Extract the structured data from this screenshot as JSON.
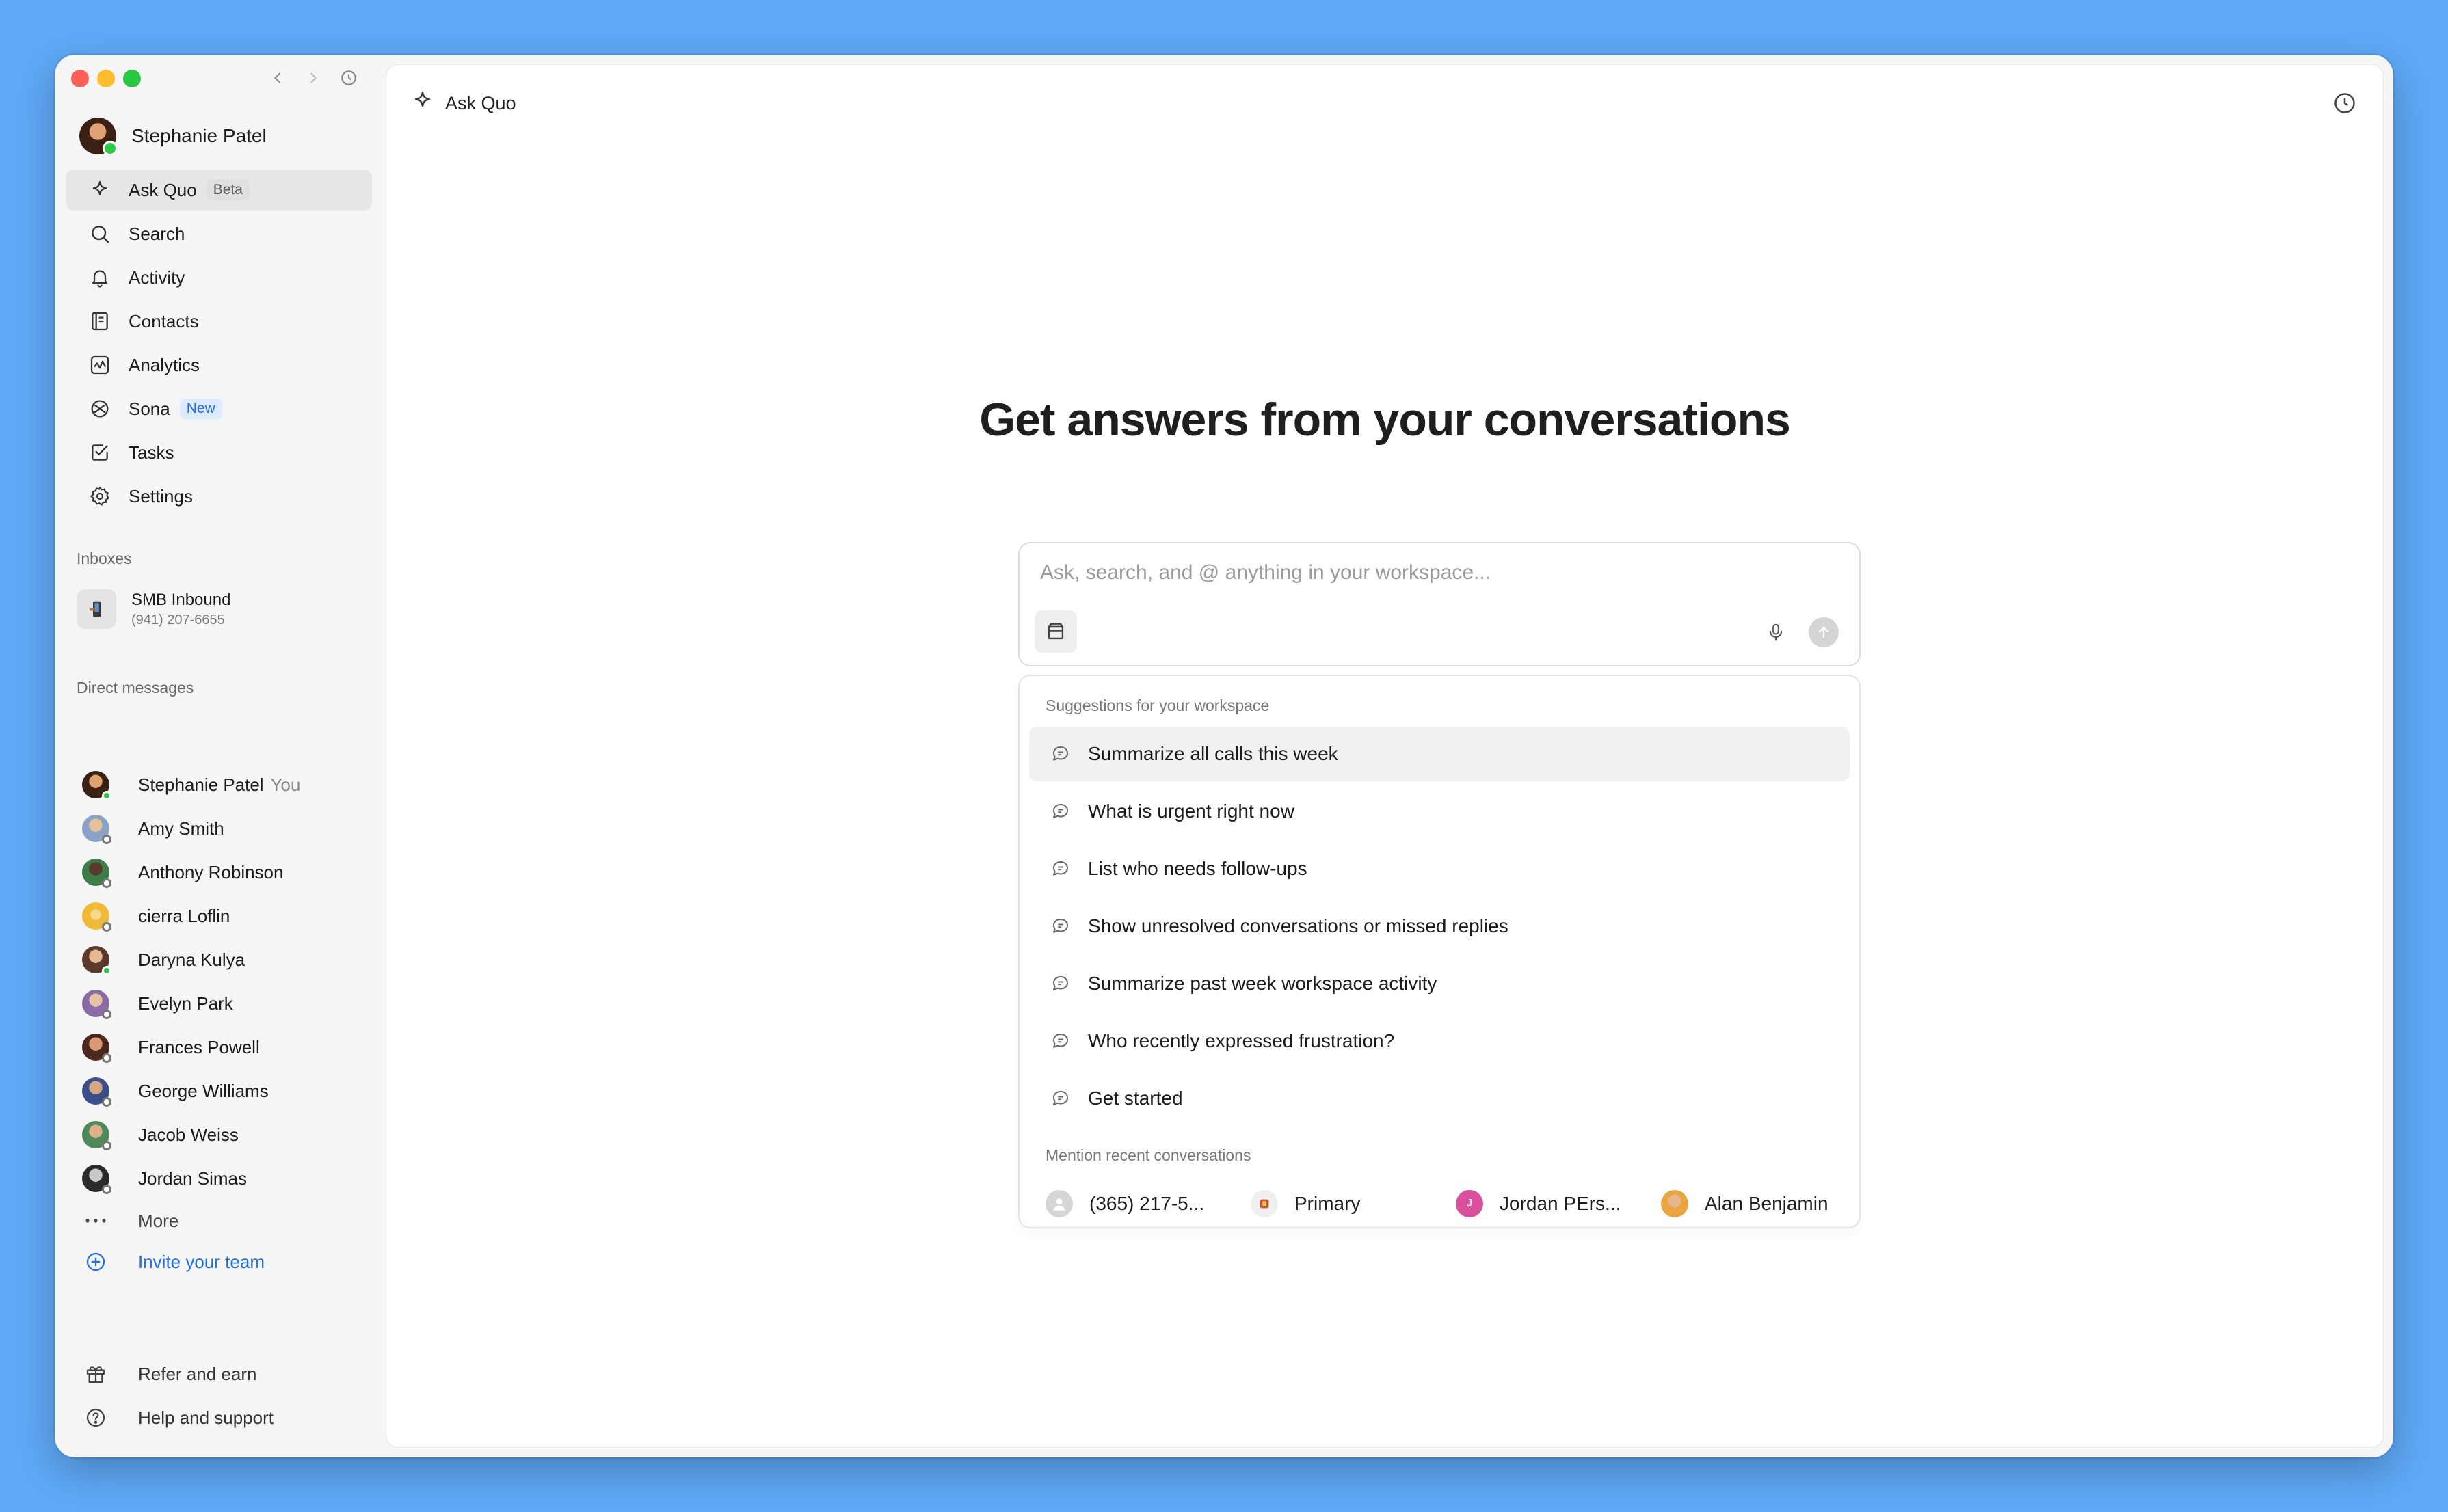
{
  "sidebar": {
    "user_name": "Stephanie Patel",
    "nav": [
      {
        "label": "Ask Quo",
        "badge": "Beta",
        "icon": "sparkle-icon"
      },
      {
        "label": "Search",
        "icon": "search-icon"
      },
      {
        "label": "Activity",
        "icon": "bell-icon"
      },
      {
        "label": "Contacts",
        "icon": "contacts-icon"
      },
      {
        "label": "Analytics",
        "icon": "analytics-icon"
      },
      {
        "label": "Sona",
        "badge": "New",
        "icon": "sona-icon"
      },
      {
        "label": "Tasks",
        "icon": "tasks-icon"
      },
      {
        "label": "Settings",
        "icon": "gear-icon"
      }
    ],
    "inboxes_label": "Inboxes",
    "inbox": {
      "name": "SMB Inbound",
      "phone": "(941) 207-6655"
    },
    "dm_label": "Direct messages",
    "dms": [
      {
        "name": "Stephanie Patel",
        "suffix": "You"
      },
      {
        "name": "Amy Smith"
      },
      {
        "name": "Anthony Robinson"
      },
      {
        "name": "cierra Loflin"
      },
      {
        "name": "Daryna Kulya"
      },
      {
        "name": "Evelyn Park"
      },
      {
        "name": "Frances Powell"
      },
      {
        "name": "George Williams"
      },
      {
        "name": "Jacob Weiss"
      },
      {
        "name": "Jordan Simas"
      }
    ],
    "more_label": "More",
    "invite_label": "Invite your team",
    "refer_label": "Refer and earn",
    "help_label": "Help and support"
  },
  "main": {
    "header_title": "Ask Quo",
    "hero_title": "Get answers from your conversations",
    "input_placeholder": "Ask, search, and @ anything in your workspace...",
    "suggestions_label": "Suggestions for your workspace",
    "suggestions": [
      "Summarize all calls this week",
      "What is urgent right now",
      "List who needs follow-ups",
      "Show unresolved conversations or missed replies",
      "Summarize past week workspace activity",
      "Who recently expressed frustration?",
      "Get started"
    ],
    "mentions_label": "Mention recent conversations",
    "mentions": [
      {
        "label": "(365) 217-5..."
      },
      {
        "label": "Primary"
      },
      {
        "label": "Jordan PErs...",
        "initial": "J"
      },
      {
        "label": "Alan Benjamin"
      }
    ]
  },
  "colors": {
    "background": "#5fa9f7",
    "accent_blue": "#1f6fe0",
    "online_green": "#2ec84a"
  }
}
